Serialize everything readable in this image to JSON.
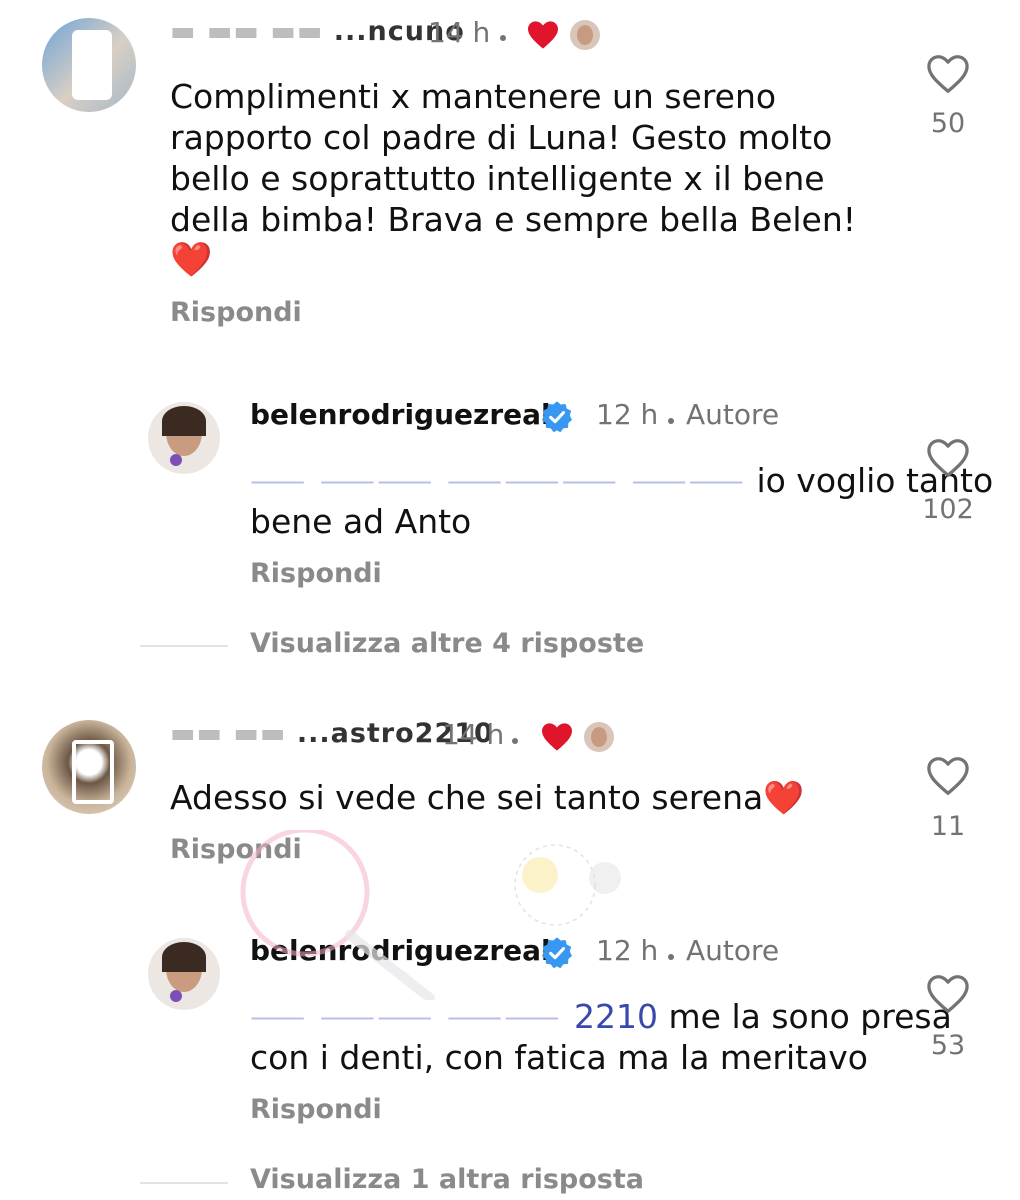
{
  "comments": [
    {
      "username_tail": "...ncuno",
      "time": "14 h",
      "text": "Complimenti x mantenere un sereno rapporto col padre di Luna!  Gesto molto bello e soprattutto intelligente x il bene della bimba! Brava e sempre bella Belen!",
      "text_lines": [
        "Complimenti x mantenere un sereno",
        "rapporto col padre di Luna!  Gesto molto",
        "bello e soprattutto intelligente x il bene",
        "della bimba! Brava e sempre bella Belen!"
      ],
      "emoji": "❤️",
      "reply_label": "Rispondi",
      "likes": "50",
      "reply": {
        "username": "belenrodriguezreal",
        "time": "12 h",
        "author_label": "Autore",
        "text_line1_visible": "io voglio tanto",
        "text_line2": "bene ad Anto",
        "reply_label": "Rispondi",
        "likes": "102"
      },
      "view_more": "Visualizza altre 4 risposte"
    },
    {
      "username_tail": "...astro2210",
      "time": "14 h",
      "text": "Adesso si vede che sei tanto serena❤️",
      "reply_label": "Rispondi",
      "likes": "11",
      "reply": {
        "username": "belenrodriguezreal",
        "time": "12 h",
        "author_label": "Autore",
        "mention_tail": "2210",
        "text_line1_visible": "me la sono presa",
        "text_line2": "con i denti, con fatica ma la meritavo",
        "reply_label": "Rispondi",
        "likes": "53"
      },
      "view_more": "Visualizza 1 altra risposta"
    }
  ],
  "icons": {
    "like": "heart-outline-icon",
    "verified": "verified-badge-icon",
    "creator_liked": "red-heart-icon"
  },
  "colors": {
    "text": "#111111",
    "muted": "#737373",
    "verified": "#3897f0",
    "heart": "#e0152b",
    "mention": "#3949ab"
  }
}
